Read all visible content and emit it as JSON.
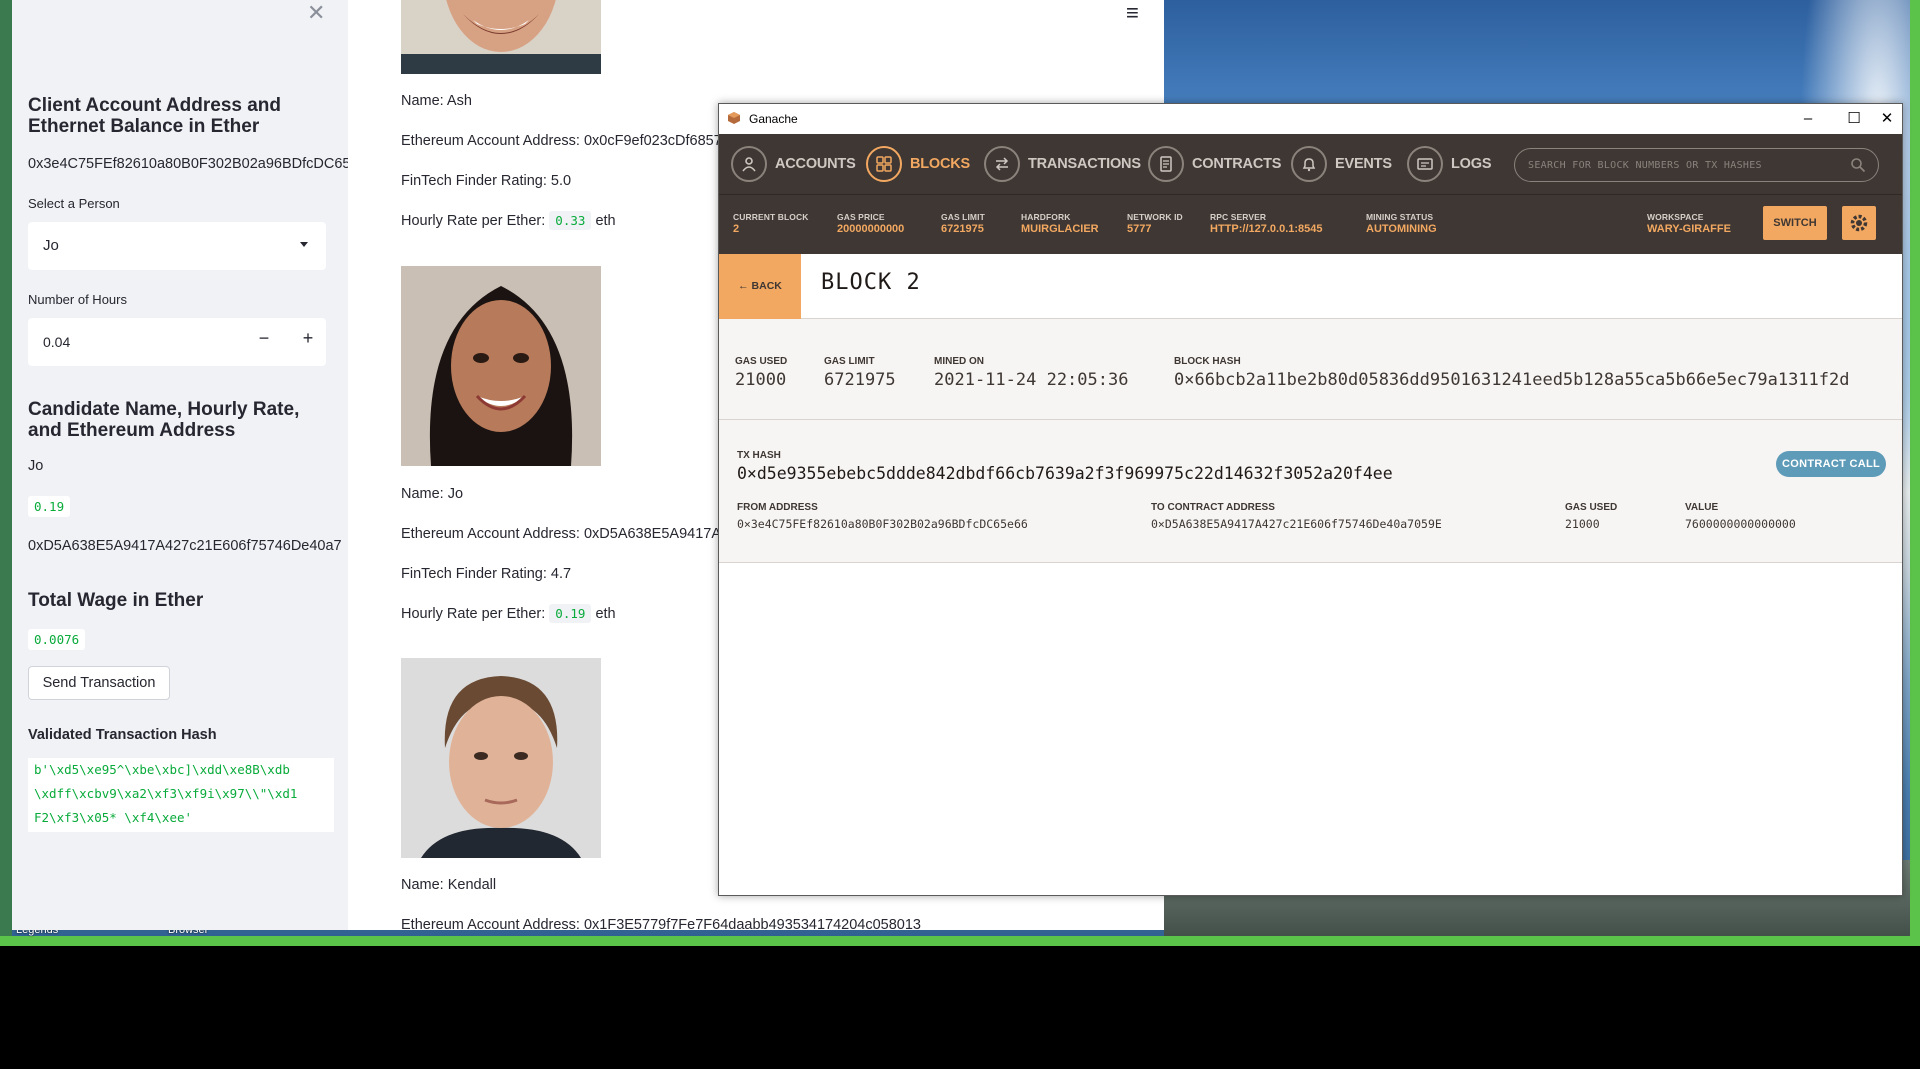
{
  "streamlit": {
    "sidebar": {
      "client_heading": "Client Account Address and Ethernet Balance in Ether",
      "client_address": "0x3e4C75FEf82610a80B0F302B02a96BDfcDC65",
      "select_label": "Select a Person",
      "select_value": "Jo",
      "hours_label": "Number of Hours",
      "hours_value": "0.04",
      "candidate_heading": "Candidate Name, Hourly Rate, and Ethereum Address",
      "candidate_name": "Jo",
      "candidate_rate": "0.19",
      "candidate_address": "0xD5A638E5A9417A427c21E606f75746De40a7",
      "wage_heading": "Total Wage in Ether",
      "wage_value": "0.0076",
      "send_button": "Send Transaction",
      "hash_heading": "Validated Transaction Hash",
      "hash_value": "b'\\xd5\\xe95^\\xbe\\xbc]\\xdd\\xe8B\\xdb\n\\xdff\\xcbv9\\xa2\\xf3\\xf9i\\x97\\\\\"\\xd1\nF2\\xf3\\x05* \\xf4\\xee'"
    },
    "candidates": [
      {
        "name": "Name: Ash",
        "address": "Ethereum Account Address: 0x0cF9ef023cDf6857",
        "rating": "FinTech Finder Rating: 5.0",
        "rate_label": "Hourly Rate per Ether:",
        "rate": "0.33",
        "unit": "eth"
      },
      {
        "name": "Name: Jo",
        "address": "Ethereum Account Address: 0xD5A638E5A9417A",
        "rating": "FinTech Finder Rating: 4.7",
        "rate_label": "Hourly Rate per Ether:",
        "rate": "0.19",
        "unit": "eth"
      },
      {
        "name": "Name: Kendall",
        "address": "Ethereum Account Address: 0x1F3E5779f7Fe7F64daabb493534174204c058013"
      }
    ]
  },
  "taskbar": {
    "item1": "Legends",
    "item2": "Browser"
  },
  "ganache": {
    "window_title": "Ganache",
    "nav": [
      "ACCOUNTS",
      "BLOCKS",
      "TRANSACTIONS",
      "CONTRACTS",
      "EVENTS",
      "LOGS"
    ],
    "search_placeholder": "SEARCH FOR BLOCK NUMBERS OR TX HASHES",
    "stats": [
      {
        "k": "CURRENT BLOCK",
        "v": "2"
      },
      {
        "k": "GAS PRICE",
        "v": "20000000000"
      },
      {
        "k": "GAS LIMIT",
        "v": "6721975"
      },
      {
        "k": "HARDFORK",
        "v": "MUIRGLACIER"
      },
      {
        "k": "NETWORK ID",
        "v": "5777"
      },
      {
        "k": "RPC SERVER",
        "v": "HTTP://127.0.0.1:8545"
      },
      {
        "k": "MINING STATUS",
        "v": "AUTOMINING"
      },
      {
        "k": "WORKSPACE",
        "v": "WARY-GIRAFFE"
      }
    ],
    "switch_label": "SWITCH",
    "back_label": "← BACK",
    "block_title": "BLOCK 2",
    "block": {
      "gas_used_k": "GAS USED",
      "gas_used": "21000",
      "gas_limit_k": "GAS LIMIT",
      "gas_limit": "6721975",
      "mined_on_k": "MINED ON",
      "mined_on": "2021-11-24 22:05:36",
      "hash_k": "BLOCK HASH",
      "hash": "0×66bcb2a11be2b80d05836dd9501631241eed5b128a55ca5b66e5ec79a1311f2d"
    },
    "tx": {
      "hash_k": "TX HASH",
      "hash": "0×d5e9355ebebc5ddde842dbdf66cb7639a2f3f969975c22d14632f3052a20f4ee",
      "badge": "CONTRACT CALL",
      "from_k": "FROM ADDRESS",
      "from": "0×3e4C75FEf82610a80B0F302B02a96BDfcDC65e66",
      "to_k": "TO CONTRACT ADDRESS",
      "to": "0×D5A638E5A9417A427c21E606f75746De40a7059E",
      "gas_k": "GAS USED",
      "gas": "21000",
      "value_k": "VALUE",
      "value": "7600000000000000"
    }
  }
}
